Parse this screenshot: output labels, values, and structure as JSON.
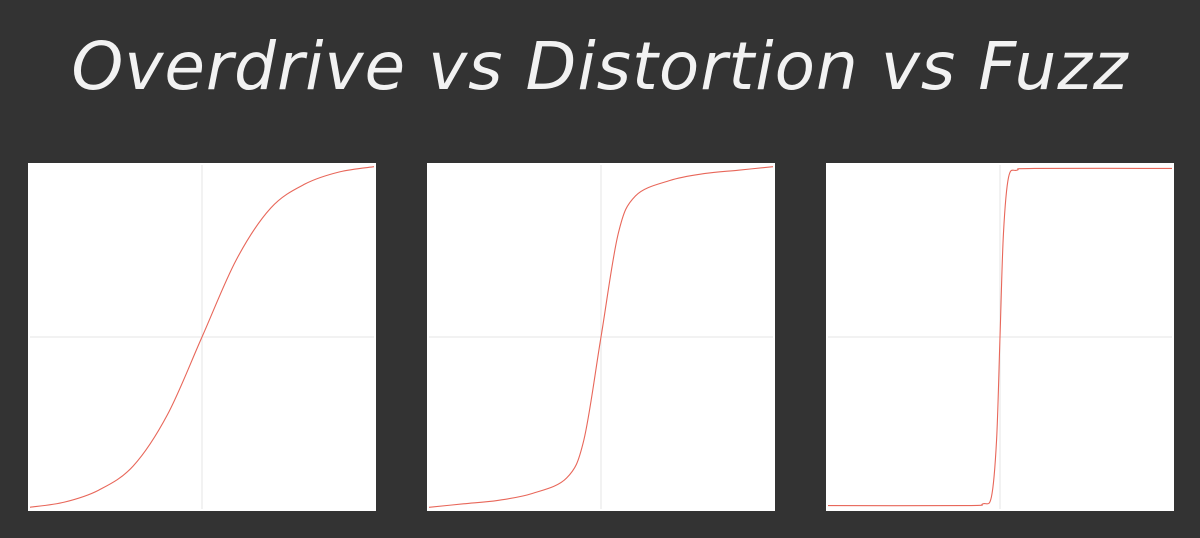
{
  "title": "Overdrive vs Distortion vs Fuzz",
  "chart_data": [
    {
      "type": "line",
      "xlim": [
        -1,
        1
      ],
      "ylim": [
        -1,
        1
      ],
      "grid": true,
      "line_color": "#e8675a",
      "series": [
        {
          "x": [
            -1,
            -0.8,
            -0.6,
            -0.4,
            -0.2,
            0,
            0.2,
            0.4,
            0.6,
            0.8,
            1
          ],
          "y": [
            -0.99,
            -0.96,
            -0.89,
            -0.75,
            -0.45,
            0,
            0.45,
            0.75,
            0.89,
            0.96,
            0.99
          ]
        }
      ]
    },
    {
      "type": "line",
      "xlim": [
        -1,
        1
      ],
      "ylim": [
        -1,
        1
      ],
      "grid": true,
      "line_color": "#e8675a",
      "series": [
        {
          "x": [
            -1,
            -0.8,
            -0.6,
            -0.4,
            -0.2,
            -0.1,
            0,
            0.1,
            0.2,
            0.4,
            0.6,
            0.8,
            1
          ],
          "y": [
            -0.99,
            -0.97,
            -0.95,
            -0.91,
            -0.82,
            -0.6,
            0,
            0.6,
            0.82,
            0.91,
            0.95,
            0.97,
            0.99
          ]
        }
      ]
    },
    {
      "type": "line",
      "xlim": [
        -1,
        1
      ],
      "ylim": [
        -1,
        1
      ],
      "grid": true,
      "line_color": "#e8675a",
      "series": [
        {
          "x": [
            -1,
            -0.2,
            -0.1,
            -0.05,
            -0.02,
            0,
            0.02,
            0.05,
            0.1,
            0.2,
            1
          ],
          "y": [
            -0.98,
            -0.98,
            -0.97,
            -0.93,
            -0.6,
            0,
            0.6,
            0.93,
            0.97,
            0.98,
            0.98
          ]
        }
      ]
    }
  ]
}
